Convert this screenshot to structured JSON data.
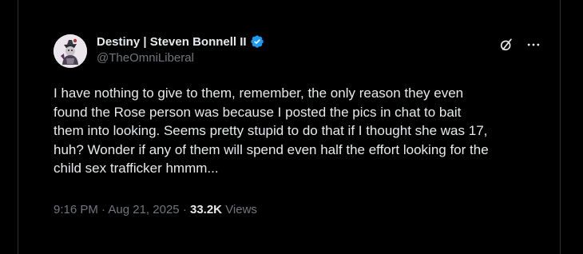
{
  "author": {
    "display_name": "Destiny | Steven Bonnell II",
    "handle": "@TheOmniLiberal",
    "verified": true,
    "verified_color": "#1d9bf0"
  },
  "header_actions": {
    "grok_icon": "grok-slash-circle-icon",
    "more_icon": "more-horizontal-icon"
  },
  "tweet": {
    "text": "I have nothing to give to them, remember, the only reason they even\nfound the Rose person was because I posted the pics in chat to bait\nthem into looking. Seems pretty stupid to do that if I thought she was 17,\nhuh? Wonder if any of them will spend even half the effort looking for the\nchild sex trafficker hmmm..."
  },
  "meta": {
    "time": "9:16 PM",
    "separator": "·",
    "date": "Aug 21, 2025",
    "views_count": "33.2K",
    "views_label": "Views"
  },
  "colors": {
    "background": "#000000",
    "text_primary": "#e7e9ea",
    "text_secondary": "#71767b"
  }
}
